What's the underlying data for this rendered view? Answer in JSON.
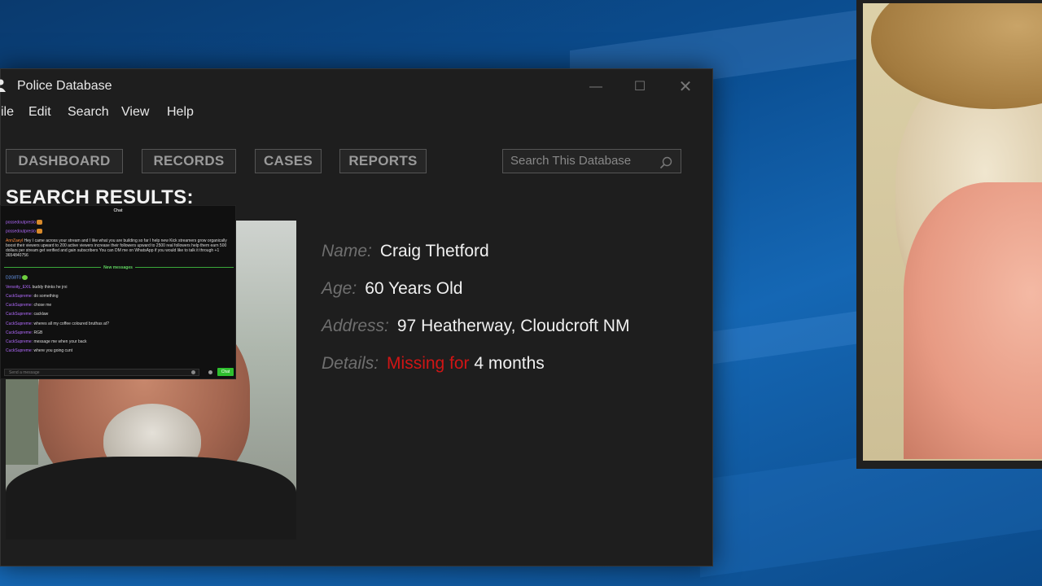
{
  "window": {
    "title": "Police Database",
    "controls": {
      "minimize": "—",
      "maximize": "☐",
      "close": "✕"
    }
  },
  "menu": [
    "ile",
    "Edit",
    "Search",
    "View",
    "Help"
  ],
  "nav": [
    "DASHBOARD",
    "RECORDS",
    "CASES",
    "REPORTS"
  ],
  "search": {
    "placeholder": "Search This Database"
  },
  "results": {
    "heading": "SEARCH RESULTS:",
    "name_label": "Name:",
    "name": "Craig Thetford",
    "age_label": "Age:",
    "age": "60 Years Old",
    "address_label": "Address:",
    "address": "97 Heatherway, Cloudcroft NM",
    "details_label": "Details:",
    "details_highlight": "Missing for",
    "details_value": "4 months"
  },
  "chat": {
    "title": "Chat",
    "messages": [
      {
        "user": "possedoutpresto",
        "text": ""
      },
      {
        "user": "possedoutpresto",
        "text": ""
      },
      {
        "user": "AnnZaeyl",
        "text": "Hey I came across your stream and I like what you are building so far I help new Kick streamers grow organically boost their viewers upward to 200 active viewers increase their followers upward to 2500 real followers help them earn 500 dollars per stream get verified and gain subscribers You can DM me on WhatsApp if you would like to talk it through +1 3654840756"
      }
    ],
    "new_messages_label": "New messages",
    "messages_new": [
      {
        "user": "D2G8T0",
        "text": ""
      },
      {
        "user": "Versoity_EXIL",
        "text": "buddy thinks he jrxi"
      },
      {
        "user": "CuckSupreme:",
        "text": "do something"
      },
      {
        "user": "CuckSupreme:",
        "text": "chose me"
      },
      {
        "user": "CuckSupreme:",
        "text": "cacklaw"
      },
      {
        "user": "CuckSupreme:",
        "text": "wheres all my coffee coloured bruthas at?"
      },
      {
        "user": "CuckSupreme:",
        "text": "RGB"
      },
      {
        "user": "CuckSupreme:",
        "text": "message me when your back"
      },
      {
        "user": "CuckSupreme:",
        "text": "where you going cunt"
      }
    ],
    "input_placeholder": "Send a message",
    "send_label": "Chat"
  }
}
